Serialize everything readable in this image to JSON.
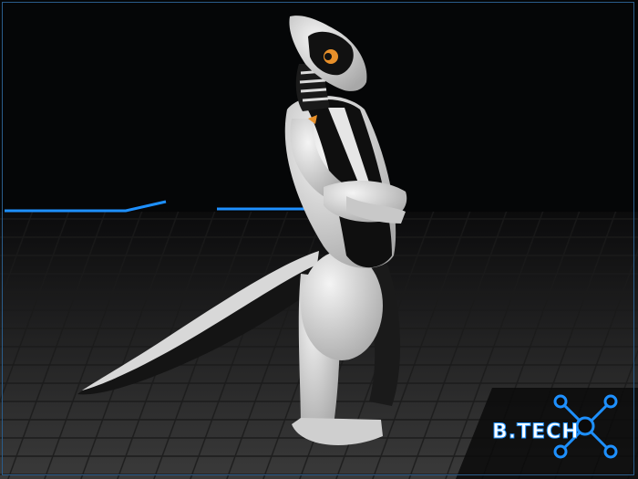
{
  "logo": {
    "text": "B.TECH",
    "accent_color": "#1e90ff",
    "icon": "circuit-node-icon"
  },
  "scene": {
    "subject": "white-black-reptilian-android-figure",
    "background_color": "#050608",
    "floor_color": "#2a2a2a",
    "glow_line_color": "#1e90ff"
  }
}
